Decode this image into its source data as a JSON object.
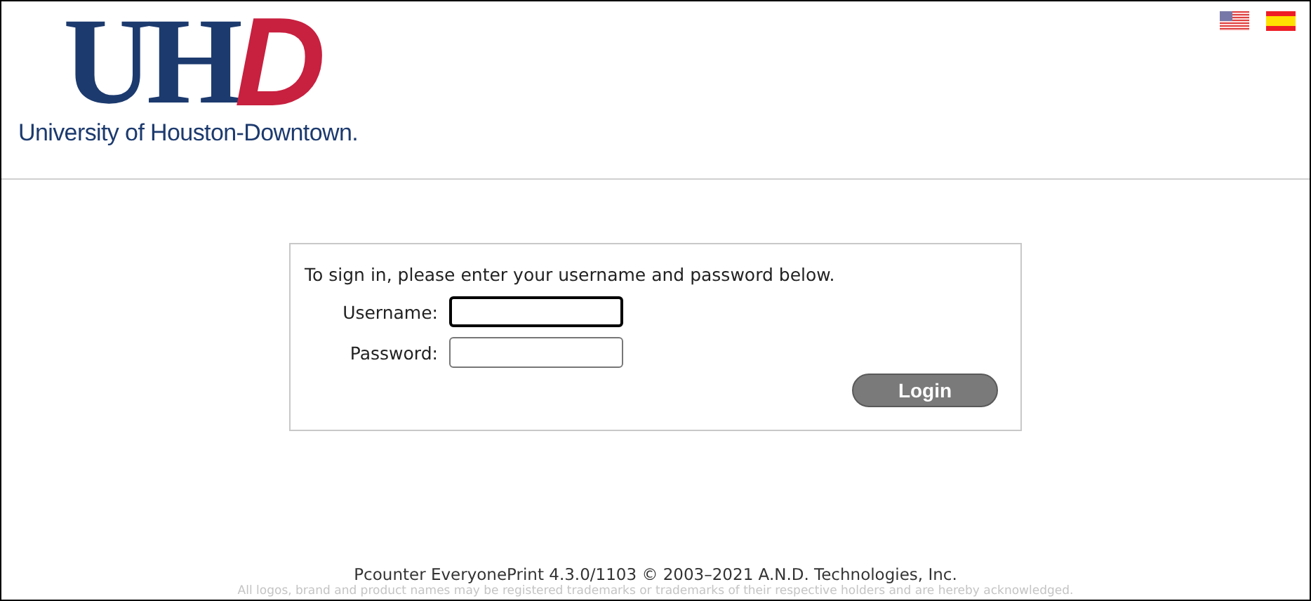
{
  "header": {
    "logo": {
      "mark_left": "UH",
      "mark_right": "D",
      "name": "University of Houston-Downtown."
    },
    "languages": [
      {
        "kind": "us"
      },
      {
        "kind": "es"
      }
    ]
  },
  "login": {
    "prompt": "To sign in, please enter your username and password below.",
    "fields": [
      {
        "label": "Username:",
        "focused": true
      },
      {
        "label": "Password:",
        "focused": false
      }
    ],
    "button": "Login"
  },
  "footer": {
    "version": "Pcounter EveryonePrint 4.3.0/1103 © 2003–2021 A.N.D. Technologies, Inc.",
    "notice": "All logos, brand and product names may be registered trademarks or trademarks of their respective holders and are hereby acknowledged."
  }
}
